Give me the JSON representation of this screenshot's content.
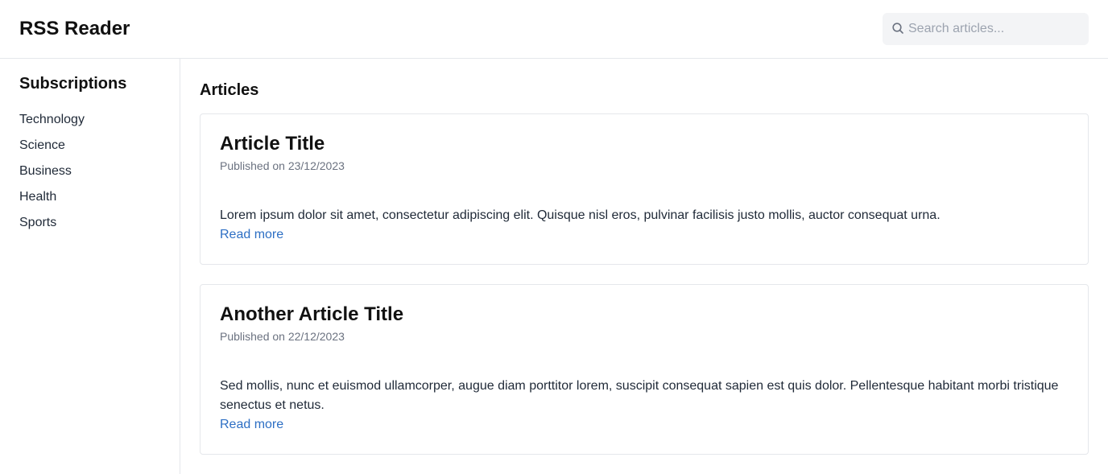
{
  "header": {
    "title": "RSS Reader",
    "search_placeholder": "Search articles..."
  },
  "sidebar": {
    "title": "Subscriptions",
    "items": [
      {
        "label": "Technology"
      },
      {
        "label": "Science"
      },
      {
        "label": "Business"
      },
      {
        "label": "Health"
      },
      {
        "label": "Sports"
      }
    ]
  },
  "main": {
    "title": "Articles",
    "articles": [
      {
        "title": "Article Title",
        "date": "Published on 23/12/2023",
        "excerpt": "Lorem ipsum dolor sit amet, consectetur adipiscing elit. Quisque nisl eros, pulvinar facilisis justo mollis, auctor consequat urna.",
        "link": "Read more"
      },
      {
        "title": "Another Article Title",
        "date": "Published on 22/12/2023",
        "excerpt": "Sed mollis, nunc et euismod ullamcorper, augue diam porttitor lorem, suscipit consequat sapien est quis dolor. Pellentesque habitant morbi tristique senectus et netus.",
        "link": "Read more"
      }
    ]
  },
  "icons": {
    "search": "search-icon"
  },
  "colors": {
    "link": "#2d6fc4",
    "border": "#e5e7eb",
    "search_bg": "#f3f4f6"
  }
}
